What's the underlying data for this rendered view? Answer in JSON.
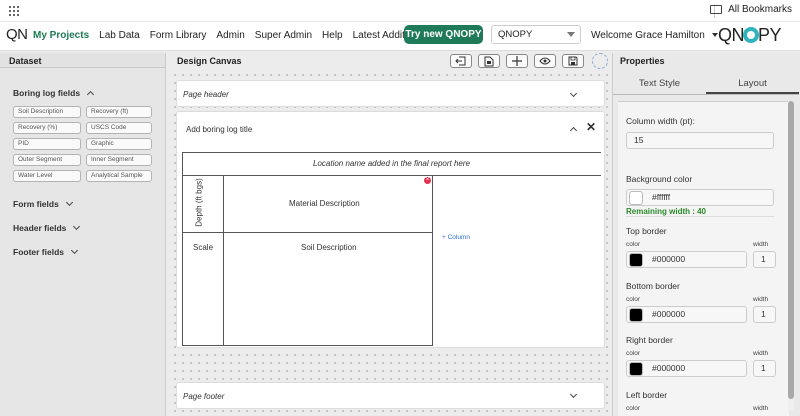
{
  "bookmarks": {
    "all_bookmarks": "All Bookmarks"
  },
  "nav": {
    "logo": "QN",
    "items": [
      "My Projects",
      "Lab Data",
      "Form Library",
      "Admin",
      "Super Admin",
      "Help",
      "Latest Additions"
    ],
    "try_button": "Try new QNOPY",
    "project_select": "QNOPY",
    "welcome": "Welcome",
    "user_name": "Grace Hamilton",
    "brand_q": "QN",
    "brand_py": "PY"
  },
  "left_panel": {
    "title": "Dataset",
    "boring_section": "Boring log fields",
    "boring_chips": [
      "Soil Description",
      "Recovery (ft)",
      "Recovery (%)",
      "USCS Code",
      "PID",
      "Graphic",
      "Outer Segment",
      "Inner Segment",
      "Water Level",
      "Analytical Sample"
    ],
    "form_fields": "Form fields",
    "header_fields": "Header fields",
    "footer_fields": "Footer fields"
  },
  "canvas": {
    "title": "Design Canvas",
    "page_header": "Page header",
    "boring_title": "Add boring log title",
    "location_text": "Location name added in the final report here",
    "depth_label": "Depth (ft bgs)",
    "material_description": "Material Description",
    "scale_label": "Scale",
    "soil_description": "Soil Description",
    "add_column": "+ Column",
    "page_footer": "Page footer",
    "close_symbol": "✕"
  },
  "properties": {
    "title": "Properties",
    "tabs": [
      "Text Style",
      "Layout"
    ],
    "active_tab": "Layout",
    "column_width_label": "Column width (pt):",
    "column_width_value": "15",
    "remaining_width": "Remaining width : 40",
    "background_color_label": "Background color",
    "background_color_value": "#ffffff",
    "top_border": "Top border",
    "bottom_border": "Bottom border",
    "right_border": "Right border",
    "left_border": "Left border",
    "color_label": "color",
    "width_label": "width",
    "border_color_value": "#000000",
    "border_width_value": "1"
  },
  "colors": {
    "accent": "#1f7a5a",
    "active_nav": "#1d7a54",
    "remaining": "#2a8a2a",
    "link": "#2d6fce",
    "brand_ring": "#2fb3bd"
  }
}
